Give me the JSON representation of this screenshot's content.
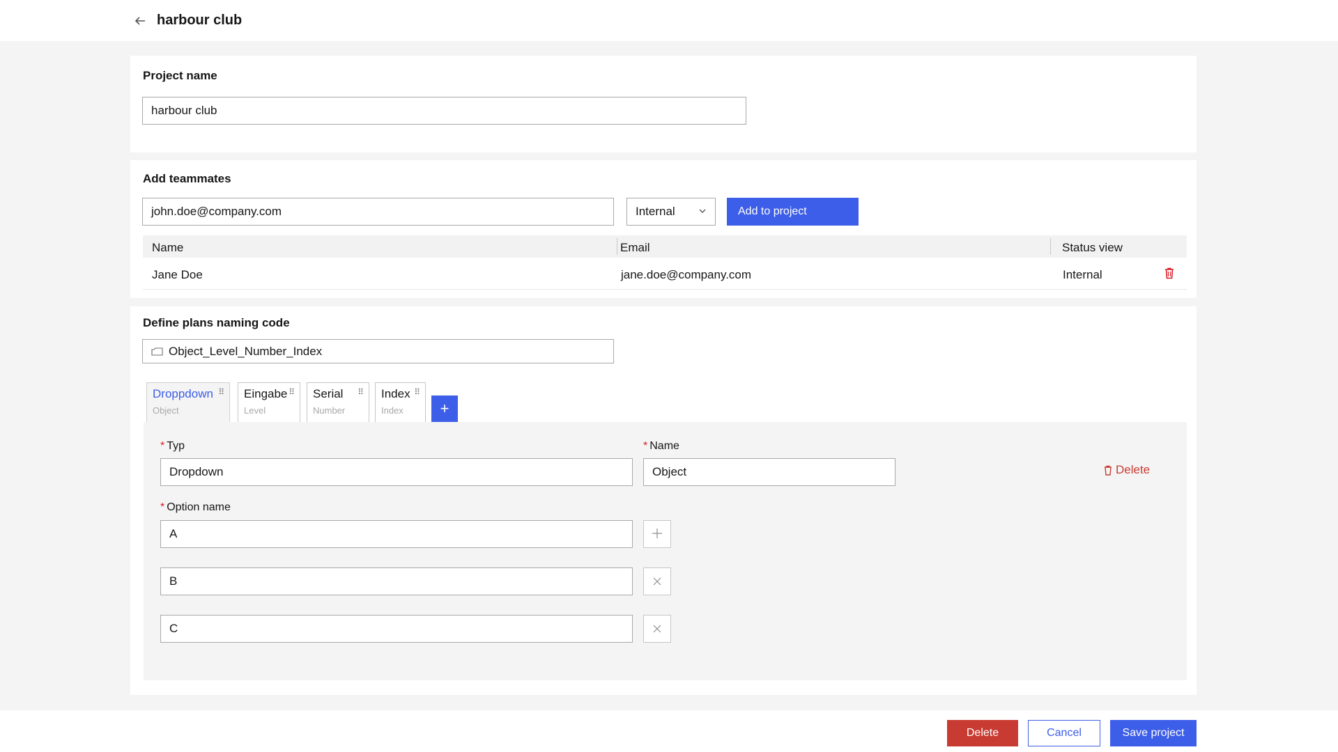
{
  "header": {
    "title": "harbour club"
  },
  "project": {
    "label": "Project name",
    "value": "harbour club"
  },
  "teammates": {
    "label": "Add teammates",
    "email_value": "john.doe@company.com",
    "role_value": "Internal",
    "add_button": "Add to project",
    "columns": [
      "Name",
      "Email",
      "Status view"
    ],
    "rows": [
      {
        "name": "Jane Doe",
        "email": "jane.doe@company.com",
        "status": "Internal"
      }
    ]
  },
  "naming": {
    "label": "Define plans naming code",
    "code_value": "Object_Level_Number_Index",
    "tabs": [
      {
        "title": "Droppdown",
        "sub": "Object"
      },
      {
        "title": "Eingabe",
        "sub": "Level"
      },
      {
        "title": "Serial",
        "sub": "Number"
      },
      {
        "title": "Index",
        "sub": "Index"
      }
    ],
    "add_tab_symbol": "+",
    "panel": {
      "typ_label": "Typ",
      "typ_value": "Dropdown",
      "name_label": "Name",
      "name_value": "Object",
      "delete_label": "Delete",
      "option_label": "Option name",
      "options": [
        "A",
        "B",
        "C"
      ]
    }
  },
  "footer": {
    "delete": "Delete",
    "cancel": "Cancel",
    "save": "Save project"
  },
  "colors": {
    "accent": "#3d5ee8",
    "danger": "#c83b32"
  }
}
